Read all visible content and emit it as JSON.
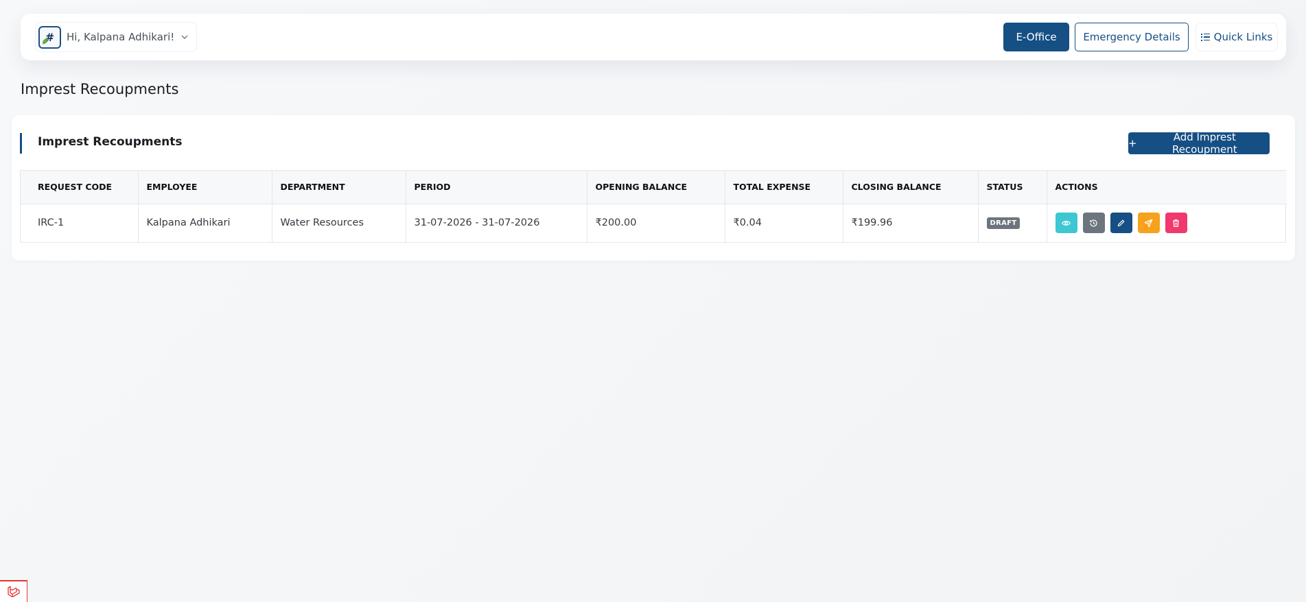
{
  "header": {
    "avatar_text": "#",
    "greeting": "Hi, Kalpana Adhikari!",
    "eoffice_label": "E-Office",
    "emergency_label": "Emergency Details",
    "quick_links_label": "Quick Links"
  },
  "page": {
    "title": "Imprest Recoupments"
  },
  "card": {
    "title": "Imprest Recoupments",
    "add_button_label": "Add Imprest Recoupment",
    "add_button_icon": "+"
  },
  "table": {
    "columns": [
      "REQUEST CODE",
      "EMPLOYEE",
      "DEPARTMENT",
      "PERIOD",
      "OPENING BALANCE",
      "TOTAL EXPENSE",
      "CLOSING BALANCE",
      "STATUS",
      "ACTIONS"
    ],
    "rows": [
      {
        "request_code": "IRC-1",
        "employee": "Kalpana Adhikari",
        "department": "Water Resources",
        "period": "31-07-2026 - 31-07-2026",
        "opening_balance": "₹200.00",
        "total_expense": "₹0.04",
        "closing_balance": "₹199.96",
        "status": "DRAFT"
      }
    ]
  },
  "action_icons": [
    "eye-icon",
    "history-icon",
    "pencil-icon",
    "send-icon",
    "trash-icon"
  ],
  "colors": {
    "primary": "#154f84",
    "view": "#3dc7d3",
    "history": "#6c757d",
    "send": "#f7a21c",
    "delete": "#f1396d"
  }
}
